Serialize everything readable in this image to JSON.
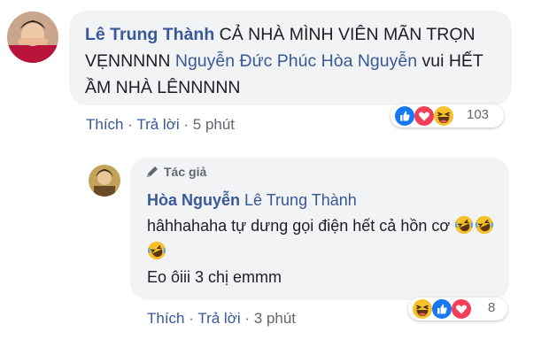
{
  "comment": {
    "author": "Lê Trung Thành",
    "text_1": "CẢ NHÀ MÌNH VIÊN MÃN TRỌN VẸNNNNN",
    "mention": "Nguyễn Đức Phúc Hòa Nguyễn",
    "text_2": "vui HẾT ẦM NHÀ LÊNNNNN",
    "like_label": "Thích",
    "reply_label": "Trả lời",
    "time": "5 phút",
    "reaction_count": "103"
  },
  "reply": {
    "badge": "Tác giả",
    "author": "Hòa Nguyễn",
    "mention": "Lê Trung Thành",
    "line_1": "hâhhahaha tự dưng gọi điện hết cả hồn cơ",
    "line_2": "Eo ôiii 3 chị emmm",
    "like_label": "Thích",
    "reply_label": "Trả lời",
    "time": "3 phút",
    "reaction_count": "8"
  },
  "colors": {
    "link": "#385898",
    "bubble": "#f2f3f5",
    "like": "#1877f2",
    "love": "#f33e58",
    "haha": "#f7b125"
  },
  "icons": [
    "like-reaction-icon",
    "love-reaction-icon",
    "haha-reaction-icon",
    "pencil-icon",
    "laughing-emoji-icon"
  ]
}
